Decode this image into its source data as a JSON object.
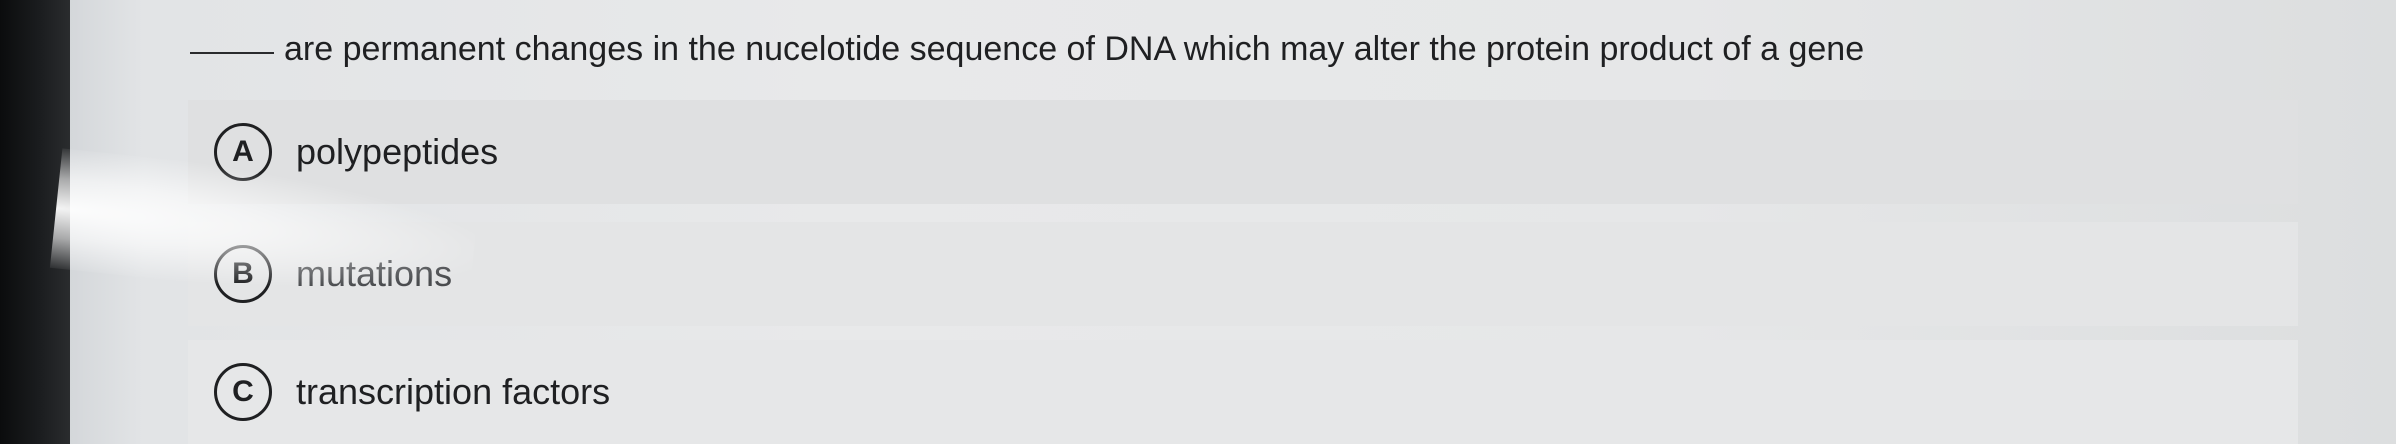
{
  "question": {
    "prompt": "are permanent changes in the nucelotide sequence of DNA which may alter the protein product of a gene"
  },
  "options": [
    {
      "letter": "A",
      "text": "polypeptides"
    },
    {
      "letter": "B",
      "text": "mutations"
    },
    {
      "letter": "C",
      "text": "transcription factors"
    }
  ]
}
